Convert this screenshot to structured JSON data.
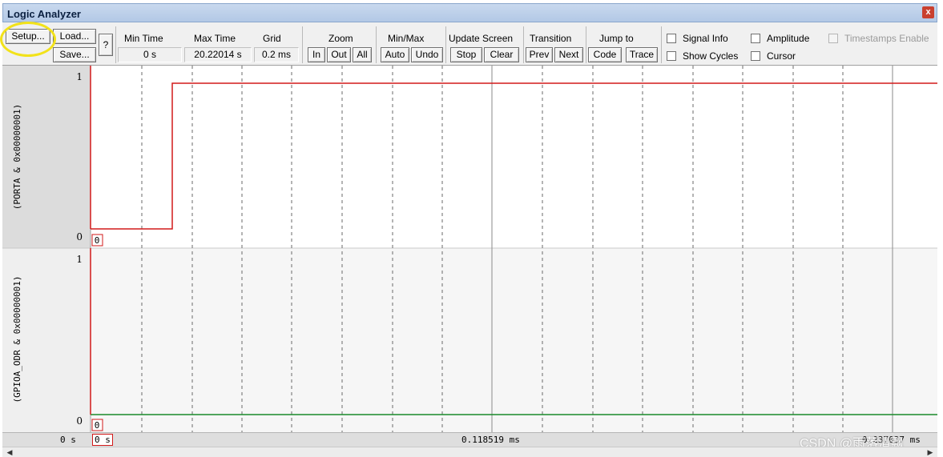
{
  "window": {
    "title": "Logic Analyzer",
    "close_glyph": "x"
  },
  "toolbar": {
    "setup_label": "Setup...",
    "load_label": "Load...",
    "save_label": "Save...",
    "help_label": "?",
    "min_time": {
      "label": "Min Time",
      "value": "0 s"
    },
    "max_time": {
      "label": "Max Time",
      "value": "20.22014 s"
    },
    "grid": {
      "label": "Grid",
      "value": "0.2 ms"
    },
    "zoom": {
      "label": "Zoom",
      "in": "In",
      "out": "Out",
      "all": "All"
    },
    "minmax": {
      "label": "Min/Max",
      "auto": "Auto",
      "undo": "Undo"
    },
    "update_screen": {
      "label": "Update Screen",
      "stop": "Stop",
      "clear": "Clear"
    },
    "transition": {
      "label": "Transition",
      "prev": "Prev",
      "next": "Next"
    },
    "jump_to": {
      "label": "Jump to",
      "code": "Code",
      "trace": "Trace"
    },
    "signal_info": {
      "label": "Signal Info",
      "checked": false
    },
    "amplitude": {
      "label": "Amplitude",
      "checked": false
    },
    "timestamps": {
      "label": "Timestamps Enable",
      "checked": false,
      "enabled": false
    },
    "show_cycles": {
      "label": "Show Cycles",
      "checked": false
    },
    "cursor": {
      "label": "Cursor",
      "checked": false
    }
  },
  "signals": [
    {
      "name": "(PORTA & 0x00000001)",
      "max_label": "1",
      "min_label": "0",
      "value_box": "0",
      "color": "#d21a1a"
    },
    {
      "name": "(GPIOA_ODR & 0x00000001)",
      "max_label": "1",
      "min_label": "0",
      "value_box": "0",
      "color": "#1a8a2a"
    }
  ],
  "status": {
    "left_time": "0 s",
    "cursor_box": "0 s",
    "center_time": "0.118519 ms",
    "right_time": "0.237037 ms"
  },
  "watermark": "CSDN @雨落清飘"
}
